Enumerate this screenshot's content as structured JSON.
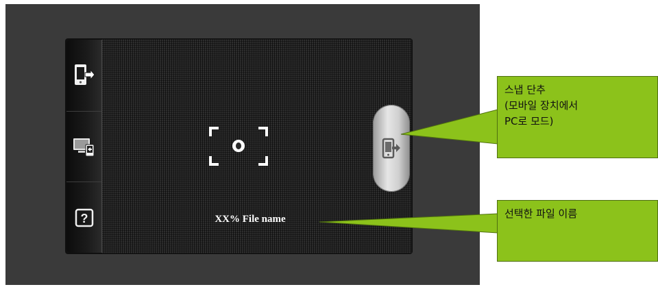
{
  "screen": {
    "file_label": "XX% File name"
  },
  "sidebar": {
    "items": [
      {
        "name": "mobile-to-pc-icon"
      },
      {
        "name": "pc-to-mobile-icon"
      },
      {
        "name": "help-icon",
        "glyph": "?"
      }
    ]
  },
  "snap_button": {
    "icon": "mobile-to-pc-icon"
  },
  "callouts": {
    "snap_shortcut": "스냅 단추\n(모바일 장치에서\nPC로 모드)",
    "selected_file": "선택한 파일 이름"
  },
  "colors": {
    "callout_fill": "#8cc21b",
    "device_body": "#3a3a3a"
  }
}
